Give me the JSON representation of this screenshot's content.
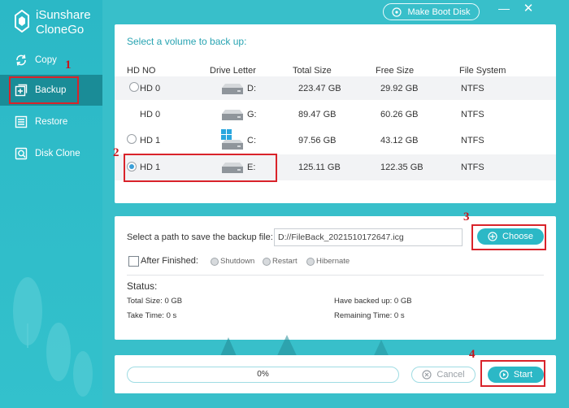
{
  "app": {
    "name": "iSunshare CloneGo",
    "name_line1": "iSunshare",
    "name_line2": "CloneGo"
  },
  "toolbar": {
    "boot_label": "Make Boot Disk",
    "minimize": "—",
    "close": "✕"
  },
  "sidebar": {
    "items": [
      {
        "label": "Copy",
        "icon": "copy-icon",
        "active": false
      },
      {
        "label": "Backup",
        "icon": "backup-icon",
        "active": true
      },
      {
        "label": "Restore",
        "icon": "restore-icon",
        "active": false
      },
      {
        "label": "Disk Clone",
        "icon": "disk-clone-icon",
        "active": false
      }
    ]
  },
  "volumes": {
    "title": "Select a volume to back up:",
    "columns": [
      "HD NO",
      "Drive Letter",
      "Total Size",
      "Free Size",
      "File System"
    ],
    "rows": [
      {
        "hd": "HD 0",
        "letter": "D:",
        "total": "223.47 GB",
        "free": "29.92 GB",
        "fs": "NTFS",
        "selected": false,
        "icon": "hard-drive-icon"
      },
      {
        "hd": "HD 0",
        "letter": "G:",
        "total": "89.47 GB",
        "free": "60.26 GB",
        "fs": "NTFS",
        "selected": false,
        "icon": "hard-drive-icon"
      },
      {
        "hd": "HD 1",
        "letter": "C:",
        "total": "97.56 GB",
        "free": "43.12 GB",
        "fs": "NTFS",
        "selected": false,
        "icon": "windows-drive-icon"
      },
      {
        "hd": "HD 1",
        "letter": "E:",
        "total": "125.11 GB",
        "free": "122.35 GB",
        "fs": "NTFS",
        "selected": true,
        "icon": "hard-drive-icon"
      }
    ]
  },
  "backup": {
    "path_label": "Select a path to save the backup file:",
    "path_value": "D://FileBack_2021510172647.icg",
    "choose_label": "Choose",
    "after_finished": "After Finished:",
    "options": [
      "Shutdown",
      "Restart",
      "Hibernate"
    ]
  },
  "status": {
    "heading": "Status:",
    "total_size": "Total Size: 0 GB",
    "take_time": "Take Time: 0 s",
    "have_backed": "Have backed up: 0 GB",
    "remaining": "Remaining Time: 0 s"
  },
  "progress": {
    "percent": 0,
    "text": "0%"
  },
  "actions": {
    "cancel_label": "Cancel",
    "start_label": "Start"
  },
  "annotations": [
    "1",
    "2",
    "3",
    "4"
  ],
  "colors": {
    "accent": "#2cb8c6",
    "sidebar_active": "#1a8c97",
    "highlight": "#d9232a"
  }
}
